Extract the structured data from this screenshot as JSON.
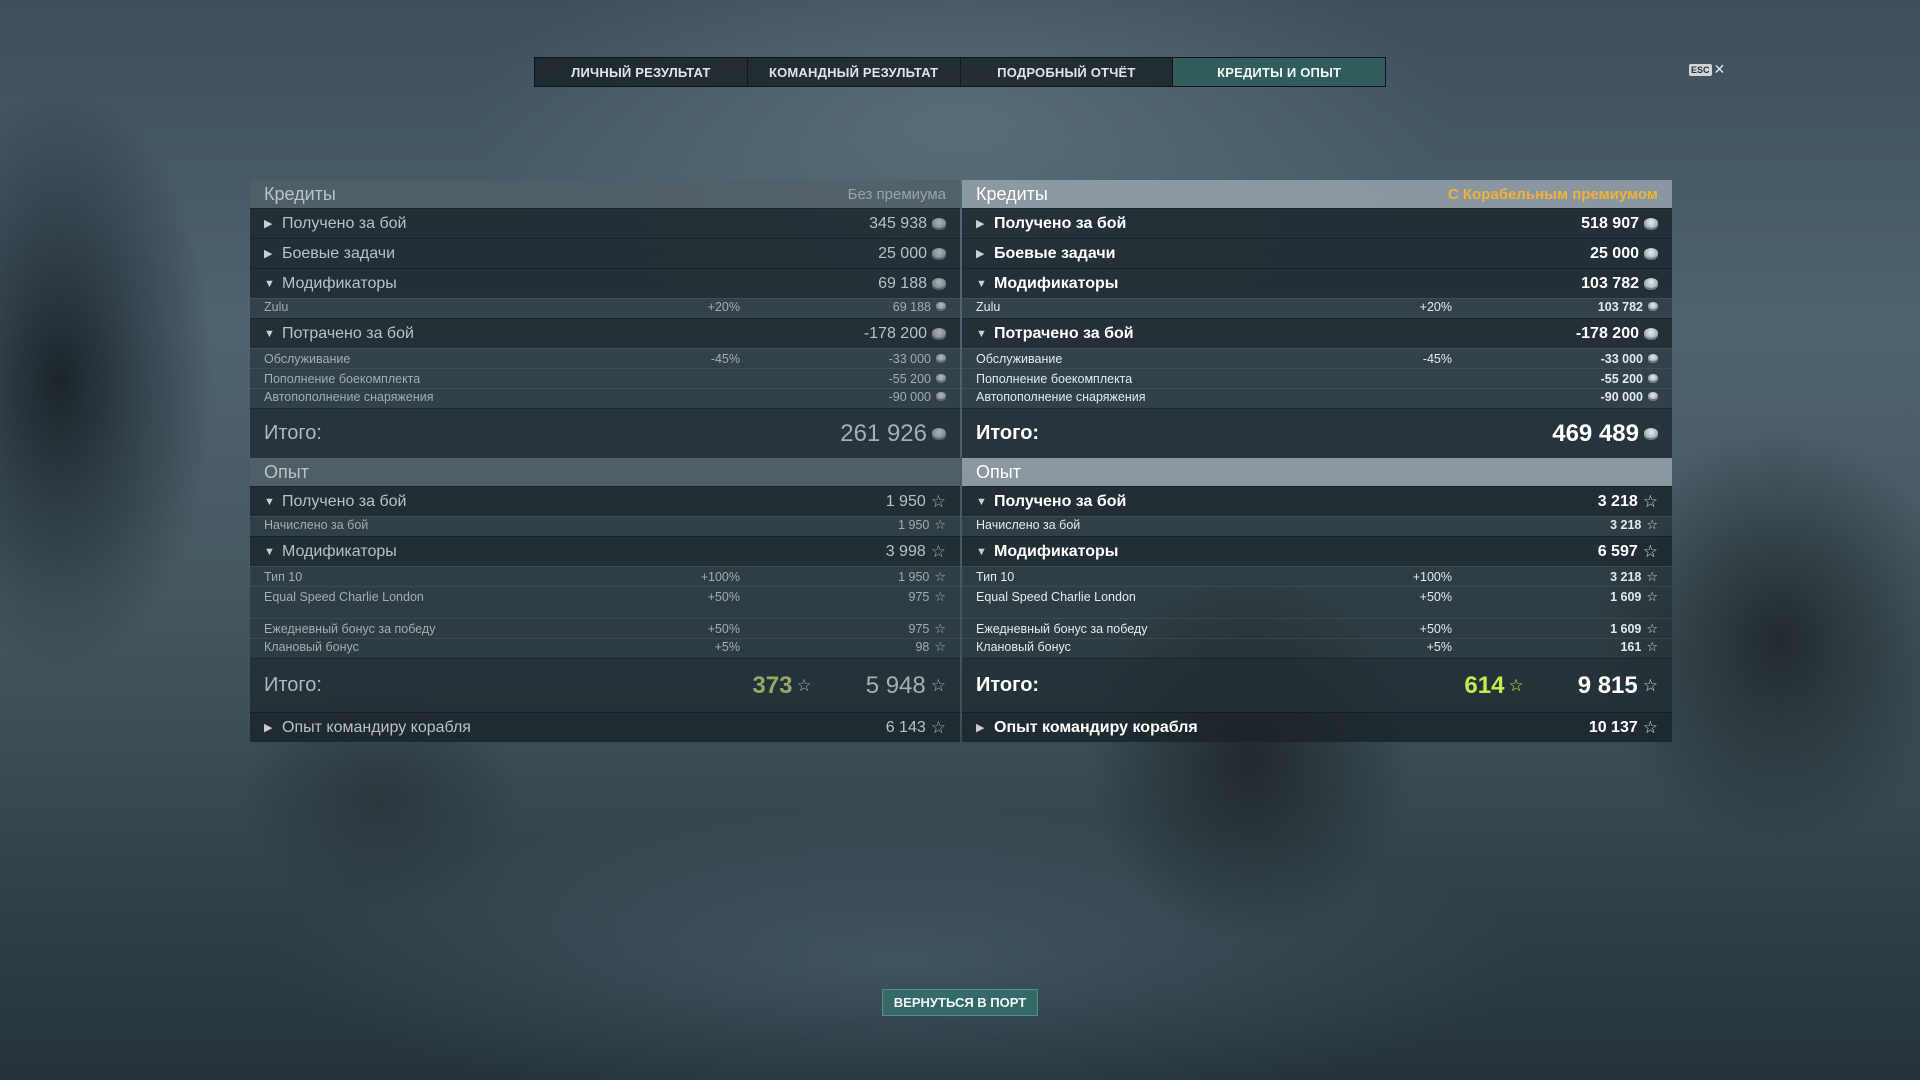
{
  "tabs": [
    "ЛИЧНЫЙ РЕЗУЛЬТАТ",
    "КОМАНДНЫЙ РЕЗУЛЬТАТ",
    "ПОДРОБНЫЙ ОТЧЁТ",
    "КРЕДИТЫ И ОПЫТ"
  ],
  "active_tab": "КРЕДИТЫ И ОПЫТ",
  "esc": {
    "key": "ESC",
    "close": "✕"
  },
  "left": {
    "credits_title": "Кредиты",
    "credits_subtitle": "Без премиума",
    "earned": {
      "label": "Получено за бой",
      "value": "345 938"
    },
    "missions": {
      "label": "Боевые задачи",
      "value": "25 000"
    },
    "modifiers": {
      "label": "Модификаторы",
      "value": "69 188"
    },
    "zulu": {
      "label": "Zulu",
      "pct": "+20%",
      "value": "69 188"
    },
    "spent": {
      "label": "Потрачено за бой",
      "value": "-178 200"
    },
    "service": {
      "label": "Обслуживание",
      "pct": "-45%",
      "value": "-33 000"
    },
    "ammo": {
      "label": "Пополнение боекомплекта",
      "value": "-55 200"
    },
    "consumables": {
      "label": "Автопополнение снаряжения",
      "value": "-90 000"
    },
    "credits_total": {
      "label": "Итого:",
      "value": "261 926"
    },
    "xp_title": "Опыт",
    "xp_earned": {
      "label": "Получено за бой",
      "value": "1 950"
    },
    "xp_accrued": {
      "label": "Начислено за бой",
      "value": "1 950"
    },
    "xp_modifiers": {
      "label": "Модификаторы",
      "value": "3 998"
    },
    "tier": {
      "label": "Тип 10",
      "pct": "+100%",
      "value": "1 950"
    },
    "signal": {
      "label": "Equal Speed Charlie London",
      "pct": "+50%",
      "value": "975"
    },
    "daily": {
      "label": "Ежедневный бонус за победу",
      "pct": "+50%",
      "value": "975"
    },
    "clan": {
      "label": "Клановый бонус",
      "pct": "+5%",
      "value": "98"
    },
    "xp_total": {
      "label": "Итого:",
      "bonus": "373",
      "value": "5 948"
    },
    "commander": {
      "label": "Опыт командиру корабля",
      "value": "6 143"
    }
  },
  "right": {
    "credits_title": "Кредиты",
    "credits_subtitle": "С Корабельным премиумом",
    "earned": {
      "label": "Получено за бой",
      "value": "518 907"
    },
    "missions": {
      "label": "Боевые задачи",
      "value": "25 000"
    },
    "modifiers": {
      "label": "Модификаторы",
      "value": "103 782"
    },
    "zulu": {
      "label": "Zulu",
      "pct": "+20%",
      "value": "103 782"
    },
    "spent": {
      "label": "Потрачено за бой",
      "value": "-178 200"
    },
    "service": {
      "label": "Обслуживание",
      "pct": "-45%",
      "value": "-33 000"
    },
    "ammo": {
      "label": "Пополнение боекомплекта",
      "value": "-55 200"
    },
    "consumables": {
      "label": "Автопополнение снаряжения",
      "value": "-90 000"
    },
    "credits_total": {
      "label": "Итого:",
      "value": "469 489"
    },
    "xp_title": "Опыт",
    "xp_earned": {
      "label": "Получено за бой",
      "value": "3 218"
    },
    "xp_accrued": {
      "label": "Начислено за бой",
      "value": "3 218"
    },
    "xp_modifiers": {
      "label": "Модификаторы",
      "value": "6 597"
    },
    "tier": {
      "label": "Тип 10",
      "pct": "+100%",
      "value": "3 218"
    },
    "signal": {
      "label": "Equal Speed Charlie London",
      "pct": "+50%",
      "value": "1 609"
    },
    "daily": {
      "label": "Ежедневный бонус за победу",
      "pct": "+50%",
      "value": "1 609"
    },
    "clan": {
      "label": "Клановый бонус",
      "pct": "+5%",
      "value": "161"
    },
    "xp_total": {
      "label": "Итого:",
      "bonus": "614",
      "value": "9 815"
    },
    "commander": {
      "label": "Опыт командиру корабля",
      "value": "10 137"
    }
  },
  "icons": {
    "credits": "credit-coin-icon",
    "xp": "star-icon",
    "expanded": "caret-down-icon",
    "collapsed": "caret-right-icon"
  },
  "colors": {
    "premium_accent": "#f0b23c",
    "xp_bonus_premium": "#c8e84e",
    "active_tab": "#346664",
    "button": "#346c68"
  },
  "back_button": "ВЕРНУТЬСЯ В ПОРТ"
}
